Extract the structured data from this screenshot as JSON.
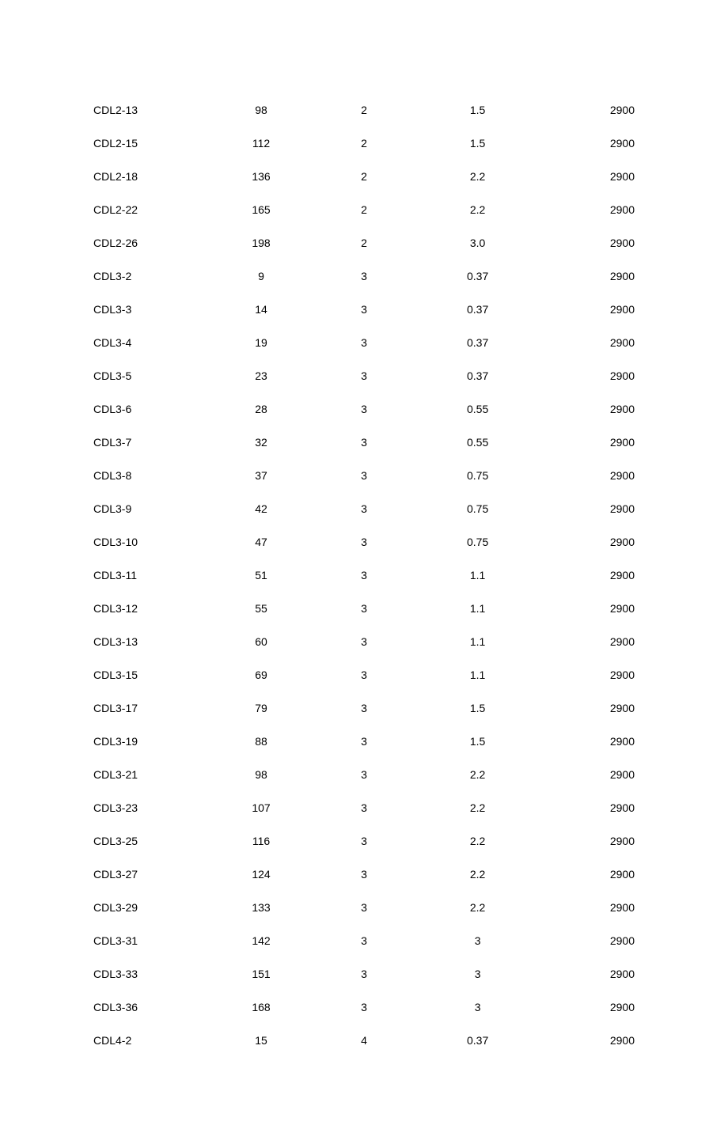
{
  "rows": [
    {
      "model": "CDL2-13",
      "head": "98",
      "flow": "2",
      "power": "1.5",
      "speed": "2900"
    },
    {
      "model": "CDL2-15",
      "head": "112",
      "flow": "2",
      "power": "1.5",
      "speed": "2900"
    },
    {
      "model": "CDL2-18",
      "head": "136",
      "flow": "2",
      "power": "2.2",
      "speed": "2900"
    },
    {
      "model": "CDL2-22",
      "head": "165",
      "flow": "2",
      "power": "2.2",
      "speed": "2900"
    },
    {
      "model": "CDL2-26",
      "head": "198",
      "flow": "2",
      "power": "3.0",
      "speed": "2900"
    },
    {
      "model": "CDL3-2",
      "head": "9",
      "flow": "3",
      "power": "0.37",
      "speed": "2900"
    },
    {
      "model": "CDL3-3",
      "head": "14",
      "flow": "3",
      "power": "0.37",
      "speed": "2900"
    },
    {
      "model": "CDL3-4",
      "head": "19",
      "flow": "3",
      "power": "0.37",
      "speed": "2900"
    },
    {
      "model": "CDL3-5",
      "head": "23",
      "flow": "3",
      "power": "0.37",
      "speed": "2900"
    },
    {
      "model": "CDL3-6",
      "head": "28",
      "flow": "3",
      "power": "0.55",
      "speed": "2900"
    },
    {
      "model": "CDL3-7",
      "head": "32",
      "flow": "3",
      "power": "0.55",
      "speed": "2900"
    },
    {
      "model": "CDL3-8",
      "head": "37",
      "flow": "3",
      "power": "0.75",
      "speed": "2900"
    },
    {
      "model": "CDL3-9",
      "head": "42",
      "flow": "3",
      "power": "0.75",
      "speed": "2900"
    },
    {
      "model": "CDL3-10",
      "head": "47",
      "flow": "3",
      "power": "0.75",
      "speed": "2900"
    },
    {
      "model": "CDL3-11",
      "head": "51",
      "flow": "3",
      "power": "1.1",
      "speed": "2900"
    },
    {
      "model": "CDL3-12",
      "head": "55",
      "flow": "3",
      "power": "1.1",
      "speed": "2900"
    },
    {
      "model": "CDL3-13",
      "head": "60",
      "flow": "3",
      "power": "1.1",
      "speed": "2900"
    },
    {
      "model": "CDL3-15",
      "head": "69",
      "flow": "3",
      "power": "1.1",
      "speed": "2900"
    },
    {
      "model": "CDL3-17",
      "head": "79",
      "flow": "3",
      "power": "1.5",
      "speed": "2900"
    },
    {
      "model": "CDL3-19",
      "head": "88",
      "flow": "3",
      "power": "1.5",
      "speed": "2900"
    },
    {
      "model": "CDL3-21",
      "head": "98",
      "flow": "3",
      "power": "2.2",
      "speed": "2900"
    },
    {
      "model": "CDL3-23",
      "head": "107",
      "flow": "3",
      "power": "2.2",
      "speed": "2900"
    },
    {
      "model": "CDL3-25",
      "head": "116",
      "flow": "3",
      "power": "2.2",
      "speed": "2900"
    },
    {
      "model": "CDL3-27",
      "head": "124",
      "flow": "3",
      "power": "2.2",
      "speed": "2900"
    },
    {
      "model": "CDL3-29",
      "head": "133",
      "flow": "3",
      "power": "2.2",
      "speed": "2900"
    },
    {
      "model": "CDL3-31",
      "head": "142",
      "flow": "3",
      "power": "3",
      "speed": "2900"
    },
    {
      "model": "CDL3-33",
      "head": "151",
      "flow": "3",
      "power": "3",
      "speed": "2900"
    },
    {
      "model": "CDL3-36",
      "head": "168",
      "flow": "3",
      "power": "3",
      "speed": "2900"
    },
    {
      "model": "CDL4-2",
      "head": "15",
      "flow": "4",
      "power": "0.37",
      "speed": "2900"
    }
  ]
}
